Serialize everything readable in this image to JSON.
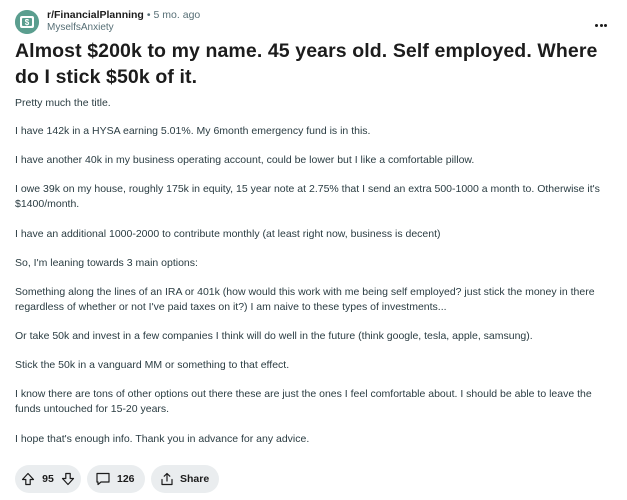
{
  "post": {
    "subreddit": "r/FinancialPlanning",
    "separator": "•",
    "age": "5 mo. ago",
    "username": "MyselfsAnxiety",
    "title": "Almost $200k to my name. 45 years old. Self employed. Where do I stick $50k of it.",
    "paragraphs": [
      "Pretty much the title.",
      "I have 142k in a HYSA earning 5.01%. My 6month emergency fund is in this.",
      "I have another 40k in my business operating account, could be lower but I like a comfortable pillow.",
      "I owe 39k on my house, roughly 175k in equity, 15 year note at 2.75% that I send an extra 500-1000 a month to. Otherwise it's $1400/month.",
      "I have an additional 1000-2000 to contribute monthly (at least right now, business is decent)",
      "So, I'm leaning towards 3 main options:",
      "Something along the lines of an IRA or 401k (how would this work with me being self employed? just stick the money in there regardless of whether or not I've paid taxes on it?) I am naive to these types of investments...",
      "Or take 50k and invest in a few companies I think will do well in the future (think google, tesla, apple, samsung).",
      "Stick the 50k in a vanguard MM or something to that effect.",
      "I know there are tons of other options out there these are just the ones I feel comfortable about. I should be able to leave the funds untouched for 15-20 years.",
      "I hope that's enough info. Thank you in advance for any advice."
    ]
  },
  "actions": {
    "vote_count": "95",
    "comment_count": "126",
    "share_label": "Share"
  },
  "icons": {
    "avatar": "subreddit-dollar-icon",
    "more": "ellipsis-icon",
    "upvote": "upvote-arrow-icon",
    "downvote": "downvote-arrow-icon",
    "comment": "comment-bubble-icon",
    "share": "share-icon"
  },
  "colors": {
    "avatar_bg": "#5b9e8f",
    "pill_bg": "#eaedef",
    "meta_text": "#576f76",
    "body_text": "#2a3c42"
  }
}
